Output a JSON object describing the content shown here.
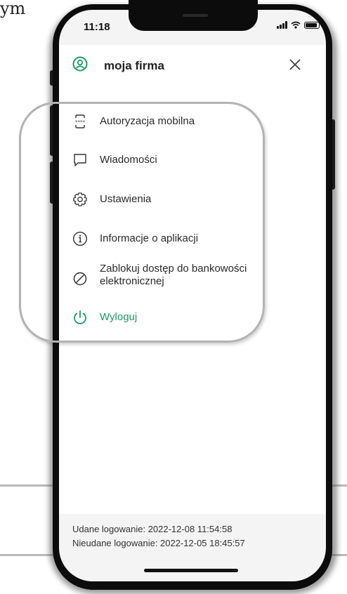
{
  "document": {
    "text_fragment": "ym"
  },
  "status_bar": {
    "time": "11:18"
  },
  "header": {
    "company_name": "moja firma"
  },
  "menu": {
    "items": [
      {
        "label": "Autoryzacja mobilna",
        "icon": "mobile-authorization-icon"
      },
      {
        "label": "Wiadomości",
        "icon": "message-icon"
      },
      {
        "label": "Ustawienia",
        "icon": "gear-icon"
      },
      {
        "label": "Informacje o aplikacji",
        "icon": "info-icon"
      },
      {
        "label": "Zablokuj dostęp do bankowości elektronicznej",
        "icon": "block-icon"
      },
      {
        "label": "Wyloguj",
        "icon": "power-icon"
      }
    ]
  },
  "login_info": {
    "success": "Udane logowanie: 2022-12-08 11:54:58",
    "failed": "Nieudane logowanie: 2022-12-05 18:45:57"
  },
  "colors": {
    "accent": "#1f9a63",
    "highlight_frame": "#b3b3b3"
  }
}
